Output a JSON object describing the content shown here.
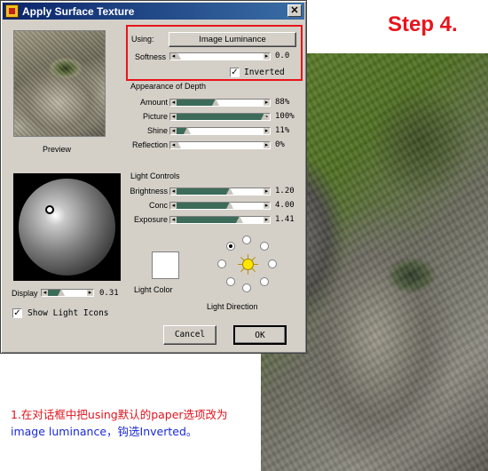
{
  "annotation": {
    "step": "Step 4.",
    "caption_line1": "1.在对话框中把using默认的paper选项改为",
    "caption_line2": "image luminance，钩选Inverted。"
  },
  "dialog": {
    "title": "Apply Surface Texture",
    "close_glyph": "✕",
    "preview_label": "Preview",
    "using_label": "Using:",
    "using_value": "Image Luminance",
    "softness_label": "Softness",
    "softness_value": "0.0",
    "inverted_label": "Inverted",
    "inverted_checked": true,
    "depth_header": "Appearance of Depth",
    "depth": [
      {
        "label": "Amount",
        "value": "88%",
        "level": 0.44
      },
      {
        "label": "Picture",
        "value": "100%",
        "level": 1.0
      },
      {
        "label": "Shine",
        "value": "11%",
        "level": 0.11
      },
      {
        "label": "Reflection",
        "value": "0%",
        "level": 0.0
      }
    ],
    "light_header": "Light Controls",
    "light": [
      {
        "label": "Brightness",
        "value": "1.20",
        "level": 0.6
      },
      {
        "label": "Conc",
        "value": "4.00",
        "level": 0.6
      },
      {
        "label": "Exposure",
        "value": "1.41",
        "level": 0.71
      }
    ],
    "display_label": "Display",
    "display_value": "0.31",
    "display_level": 0.31,
    "show_icons_label": "Show Light Icons",
    "show_icons_checked": true,
    "light_color_label": "Light Color",
    "light_direction_label": "Light Direction",
    "cancel_label": "Cancel",
    "ok_label": "OK",
    "colors": {
      "highlight": "#e8141b",
      "slider_fill": "#3d6b5a",
      "title_bar": "#0a246a"
    }
  }
}
